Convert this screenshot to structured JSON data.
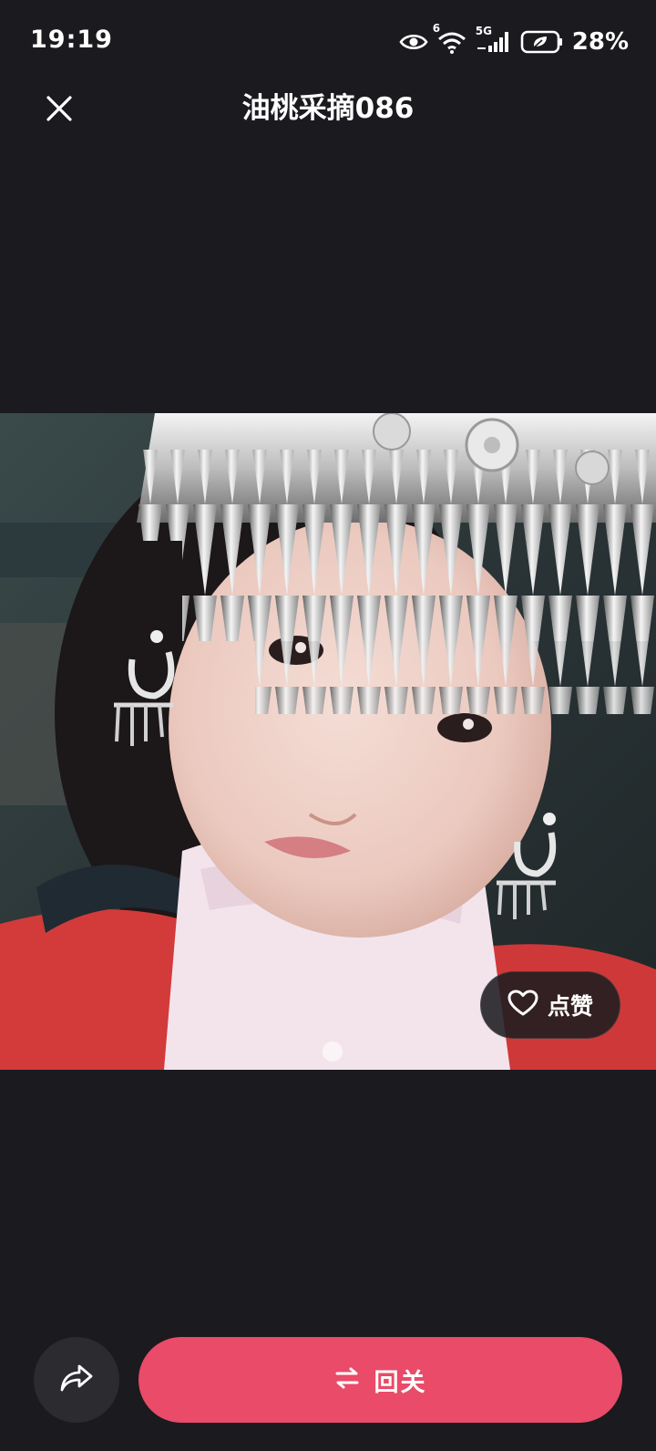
{
  "status_bar": {
    "time": "19:19",
    "network": "5G",
    "wifi_badge": "6",
    "battery_percent": "28%",
    "icons": [
      "eye-icon",
      "wifi-icon",
      "cellular-signal-icon",
      "battery-icon"
    ]
  },
  "header": {
    "title": "油桃采摘086",
    "close_icon": "close-icon"
  },
  "photo": {
    "like_label": "点赞",
    "like_icon": "heart-icon"
  },
  "actions": {
    "share_icon": "share-icon",
    "follow_back_label": "回关",
    "follow_back_icon": "swap-arrows-icon"
  },
  "colors": {
    "background": "#1a1a1f",
    "accent": "#e94b68",
    "share_button_bg": "#2b2b30"
  }
}
